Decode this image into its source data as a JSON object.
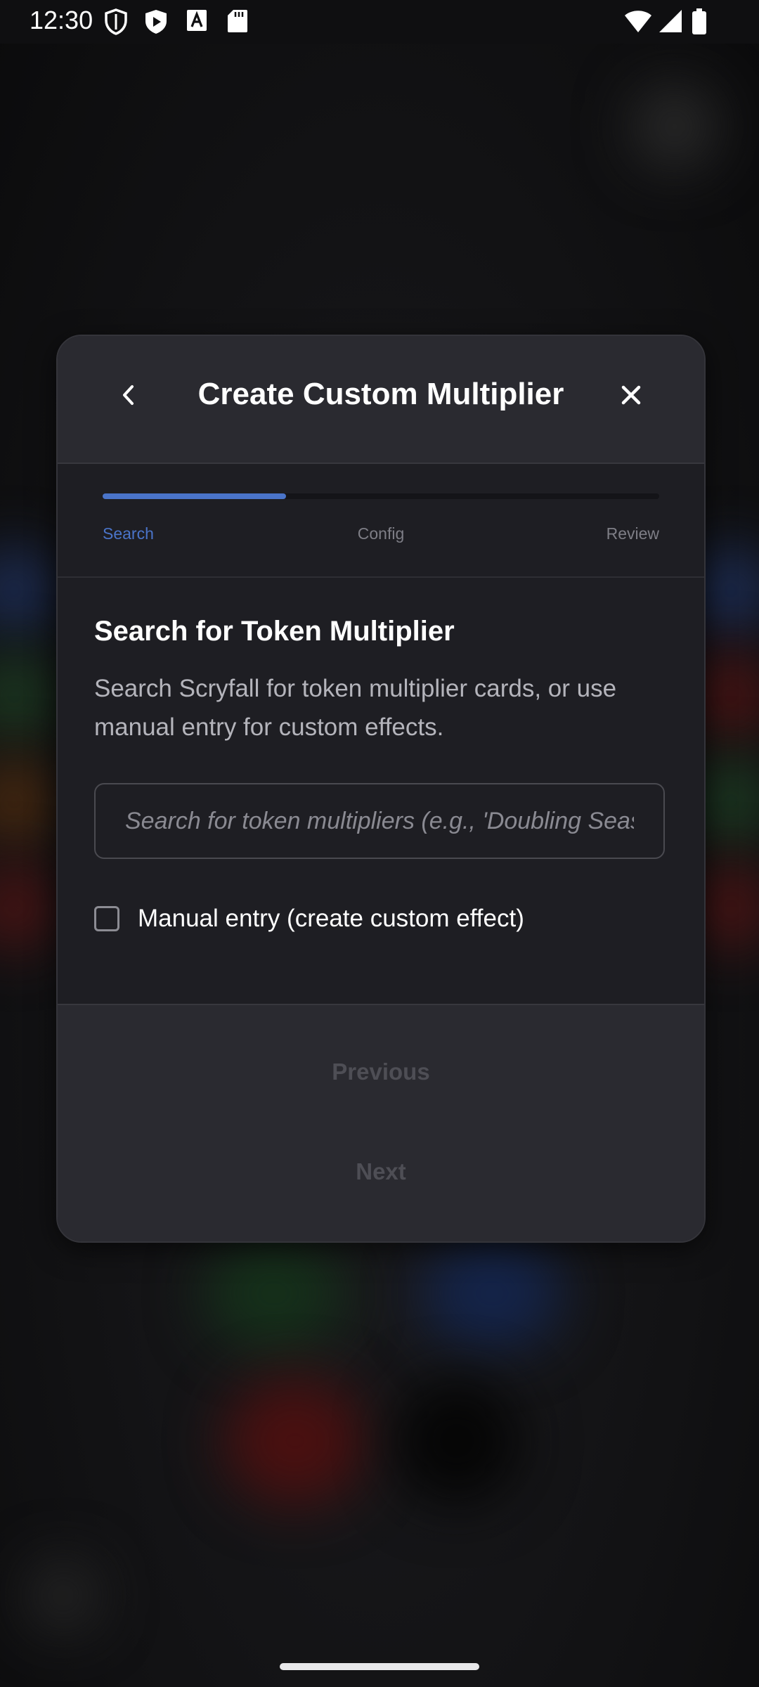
{
  "status_bar": {
    "time": "12:30",
    "left_icons": [
      "shield-icon",
      "play-protect-icon",
      "font-a-icon",
      "sd-card-icon"
    ],
    "right_icons": [
      "wifi-icon",
      "signal-icon",
      "battery-icon"
    ]
  },
  "dialog": {
    "title": "Create Custom Multiplier",
    "back_icon": "chevron-left-icon",
    "close_icon": "close-icon",
    "stepper": {
      "progress_fraction": 0.33,
      "accent_color": "#4a74c9",
      "steps": [
        {
          "label": "Search",
          "active": true
        },
        {
          "label": "Config",
          "active": false
        },
        {
          "label": "Review",
          "active": false
        }
      ]
    },
    "content": {
      "heading": "Search for Token Multiplier",
      "description": "Search Scryfall for token multiplier cards, or use manual entry for custom effects.",
      "search": {
        "value": "",
        "placeholder": "Search for token multipliers (e.g., 'Doubling Season')"
      },
      "manual_entry": {
        "label": "Manual entry (create custom effect)",
        "checked": false
      }
    },
    "footer": {
      "previous_label": "Previous",
      "next_label": "Next"
    }
  }
}
